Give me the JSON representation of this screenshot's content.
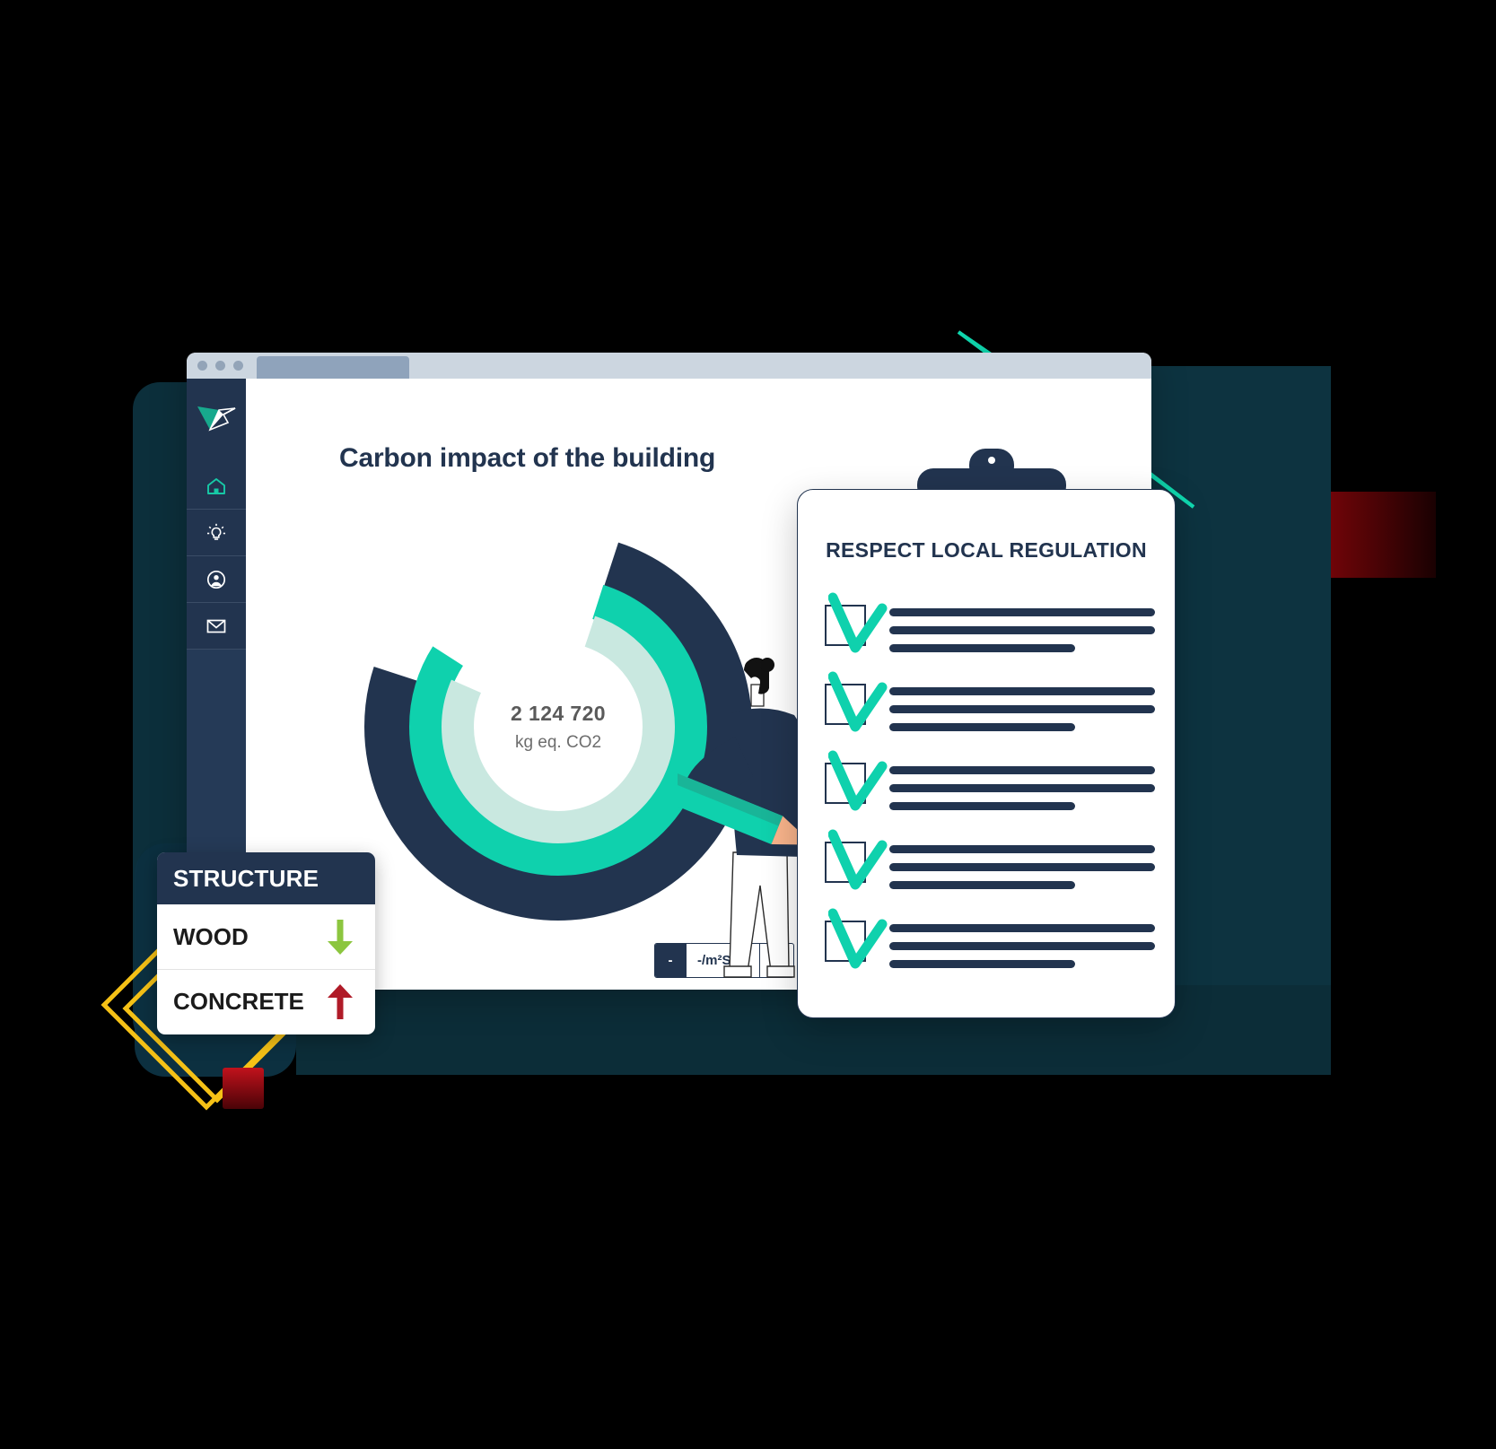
{
  "window": {
    "traffic_lights": [
      "dot-1",
      "dot-2",
      "dot-3"
    ],
    "tab_label": ""
  },
  "sidebar": {
    "logo_name": "origami-bird-logo",
    "items": [
      {
        "icon": "home-icon",
        "label": "Home"
      },
      {
        "icon": "lightbulb-icon",
        "label": "Insights"
      },
      {
        "icon": "account-icon",
        "label": "Account"
      },
      {
        "icon": "mail-icon",
        "label": "Messages"
      }
    ]
  },
  "main": {
    "title": "Carbon impact of the building",
    "donut": {
      "value": "2 124 720",
      "unit": "kg eq. CO2"
    },
    "unit_toggle": {
      "options": [
        "-",
        "-/m²Sref",
        "%"
      ],
      "selected": "-"
    }
  },
  "structure_card": {
    "title": "STRUCTURE",
    "rows": [
      {
        "label": "WOOD",
        "trend": "down",
        "trend_icon": "arrow-down-icon",
        "color": "#8cc63f"
      },
      {
        "label": "CONCRETE",
        "trend": "up",
        "trend_icon": "arrow-up-icon",
        "color": "#b01b28"
      }
    ]
  },
  "clipboard": {
    "title": "RESPECT LOCAL REGULATION",
    "items": [
      {
        "checked": true,
        "check_icon": "check-icon",
        "lines": [
          "",
          "",
          ""
        ]
      },
      {
        "checked": true,
        "check_icon": "check-icon",
        "lines": [
          "",
          "",
          ""
        ]
      },
      {
        "checked": true,
        "check_icon": "check-icon",
        "lines": [
          "",
          "",
          ""
        ]
      },
      {
        "checked": true,
        "check_icon": "check-icon",
        "lines": [
          "",
          "",
          ""
        ]
      },
      {
        "checked": true,
        "check_icon": "check-icon",
        "lines": [
          "",
          "",
          ""
        ]
      }
    ]
  },
  "colors": {
    "navy": "#22344f",
    "teal": "#0fd1ad",
    "teal_light": "#c9e8e0",
    "green": "#8cc63f",
    "red": "#b01b28",
    "yellow": "#f5c116",
    "grey_text": "#5a5a5a",
    "titlebar": "#ccd6e0",
    "background": "#000000"
  },
  "chart_data": {
    "type": "pie",
    "title": "Carbon impact of the building",
    "center_label": "2 124 720",
    "center_sublabel": "kg eq. CO2",
    "rings": [
      {
        "name": "outer-ring",
        "color": "#22344f",
        "start_deg": 40,
        "sweep_deg": 270
      },
      {
        "name": "middle-ring",
        "color": "#0fd1ad",
        "start_deg": 40,
        "sweep_deg": 285
      },
      {
        "name": "inner-ring",
        "color": "#c9e8e0",
        "start_deg": 42,
        "sweep_deg": 275
      }
    ],
    "legend": [],
    "xlabel": "",
    "ylabel": ""
  }
}
